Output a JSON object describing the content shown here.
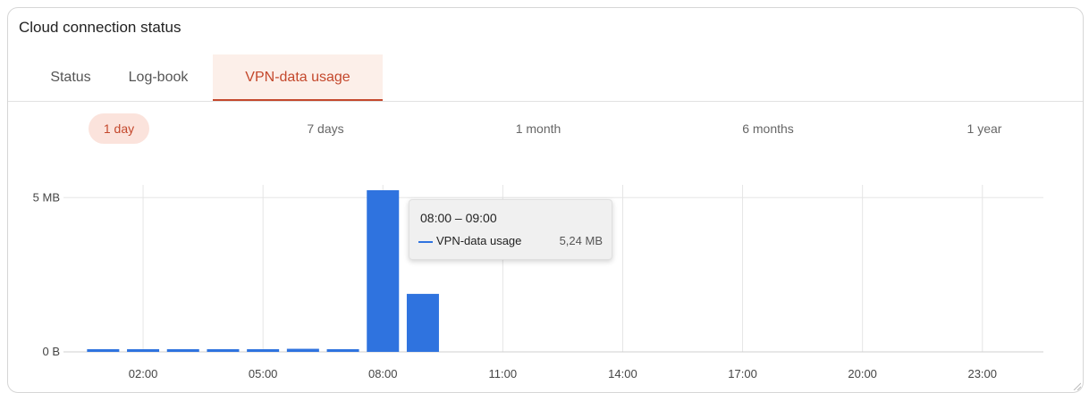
{
  "card": {
    "title": "Cloud connection status"
  },
  "tabs": [
    {
      "label": "Status",
      "active": false
    },
    {
      "label": "Log-book",
      "active": false
    },
    {
      "label": "VPN-data usage",
      "active": true
    }
  ],
  "ranges": [
    {
      "label": "1 day",
      "active": true
    },
    {
      "label": "7 days",
      "active": false
    },
    {
      "label": "1 month",
      "active": false
    },
    {
      "label": "6 months",
      "active": false
    },
    {
      "label": "1 year",
      "active": false
    }
  ],
  "colors": {
    "accent": "#c4482c",
    "bar": "#2f73df",
    "grid": "#e5e5e5"
  },
  "chart_data": {
    "type": "bar",
    "categories": [
      "01:00",
      "02:00",
      "03:00",
      "04:00",
      "05:00",
      "06:00",
      "07:00",
      "08:00",
      "09:00",
      "10:00",
      "11:00",
      "12:00",
      "13:00",
      "14:00",
      "15:00",
      "16:00",
      "17:00",
      "18:00",
      "19:00",
      "20:00",
      "21:00",
      "22:00",
      "23:00"
    ],
    "series": [
      {
        "name": "VPN-data usage",
        "values": [
          0.08,
          0.08,
          0.08,
          0.08,
          0.08,
          0.1,
          0.07,
          5.24,
          1.88,
          0,
          0,
          0,
          0,
          0,
          0,
          0,
          0,
          0,
          0,
          0,
          0,
          0,
          0
        ]
      }
    ],
    "xticks": [
      "02:00",
      "05:00",
      "08:00",
      "11:00",
      "14:00",
      "17:00",
      "20:00",
      "23:00"
    ],
    "yticks": [
      {
        "value": 0,
        "label": "0 B"
      },
      {
        "value": 5,
        "label": "5 MB"
      }
    ],
    "ylim": [
      0,
      5.24
    ],
    "unit": "MB",
    "grid": true
  },
  "tooltip": {
    "title": "08:00 – 09:00",
    "series": "VPN-data usage",
    "value": "5,24 MB"
  }
}
